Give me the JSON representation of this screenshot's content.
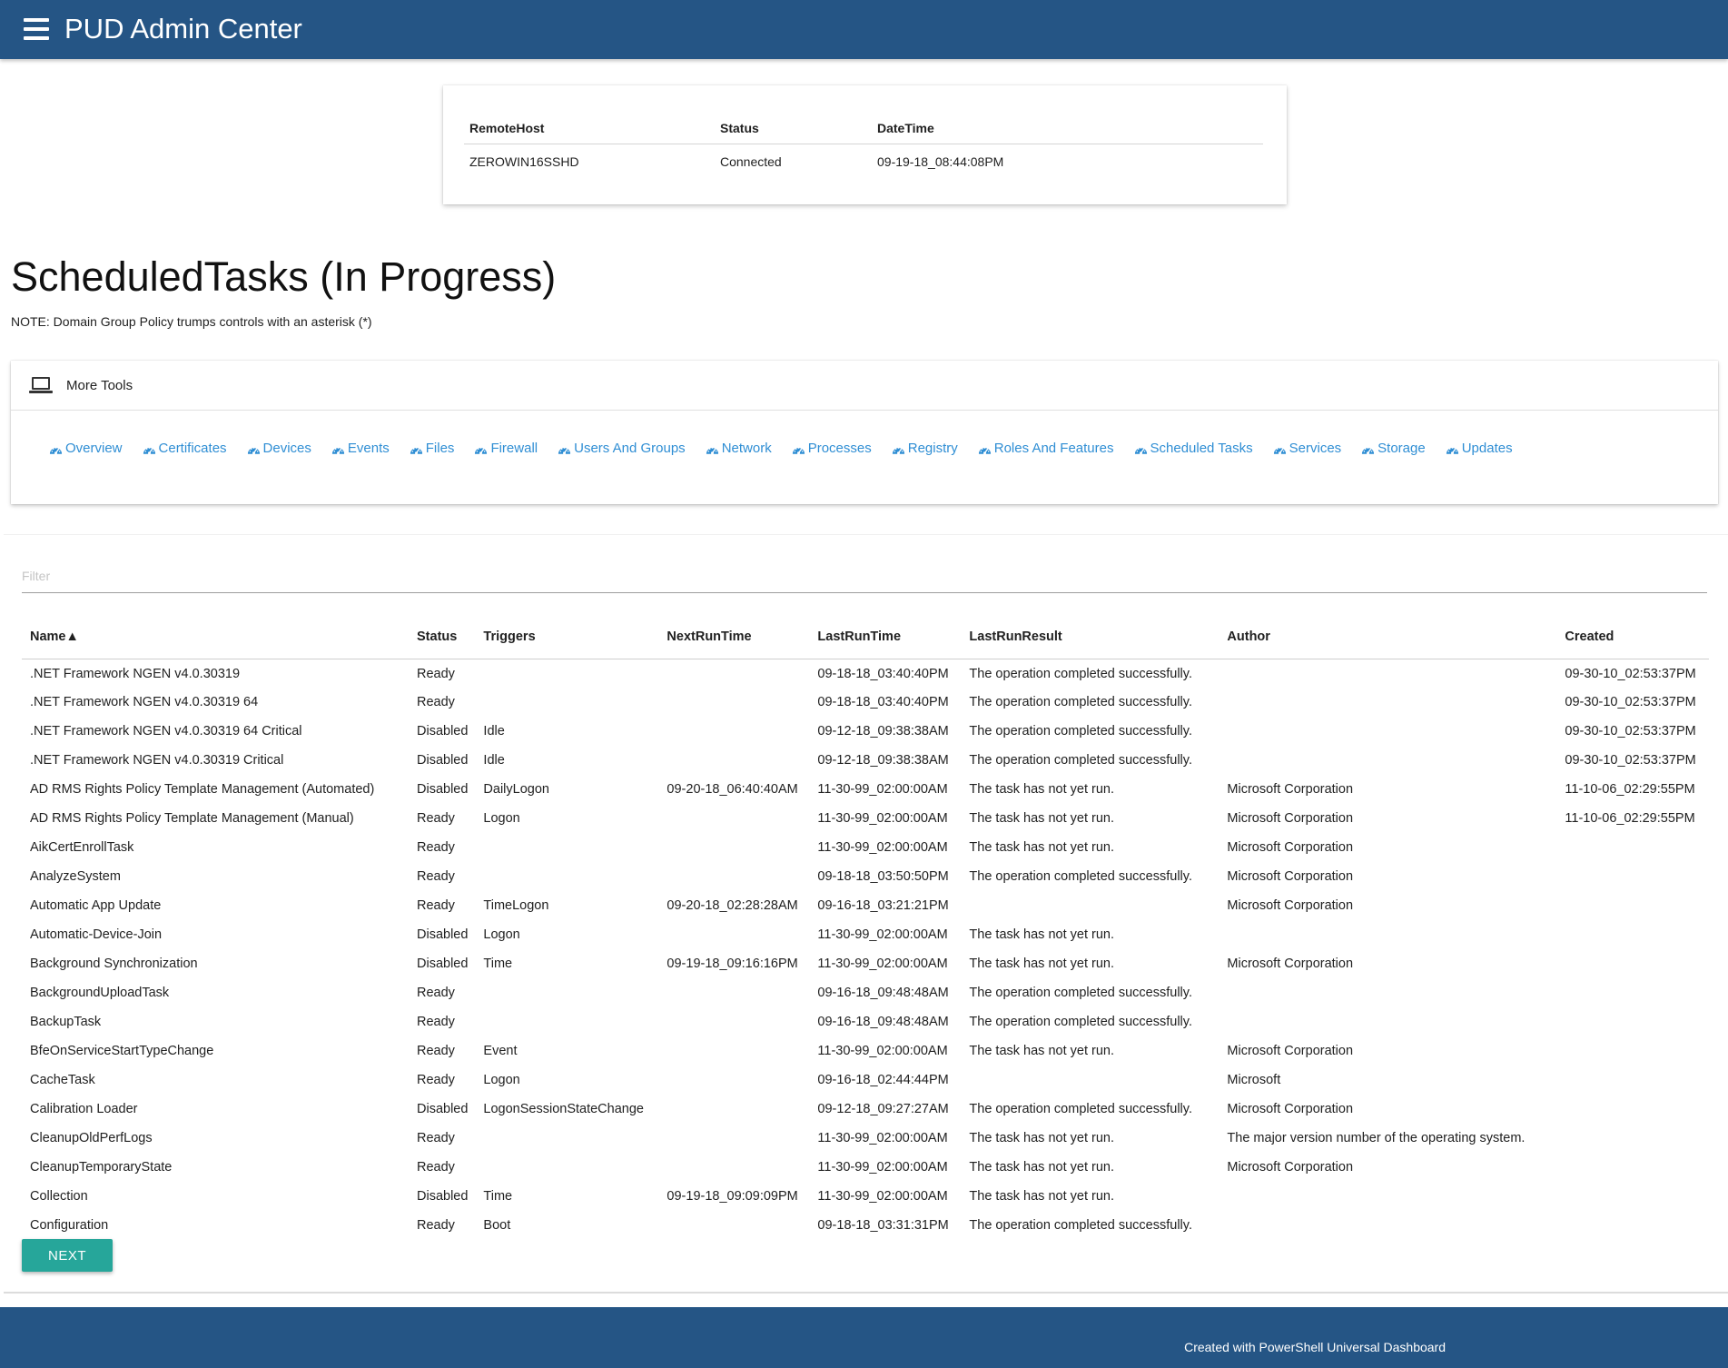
{
  "header": {
    "title": "PUD Admin Center",
    "menu_icon": "hamburger-menu-icon"
  },
  "connection": {
    "columns": [
      "RemoteHost",
      "Status",
      "DateTime"
    ],
    "row": {
      "remote_host": "ZEROWIN16SSHD",
      "status": "Connected",
      "datetime": "09-19-18_08:44:08PM"
    }
  },
  "page": {
    "title": "ScheduledTasks (In Progress)",
    "note": "NOTE: Domain Group Policy trumps controls with an asterisk (*)"
  },
  "tools": {
    "header_label": "More Tools",
    "header_icon": "laptop-icon",
    "link_icon": "dashboard-gauge-icon",
    "link_color": "#2f8ed4",
    "links": [
      "Overview",
      "Certificates",
      "Devices",
      "Events",
      "Files",
      "Firewall",
      "Users And Groups",
      "Network",
      "Processes",
      "Registry",
      "Roles And Features",
      "Scheduled Tasks",
      "Services",
      "Storage",
      "Updates"
    ]
  },
  "grid": {
    "filter_placeholder": "Filter",
    "columns": [
      "Name▲",
      "Status",
      "Triggers",
      "NextRunTime",
      "LastRunTime",
      "LastRunResult",
      "Author",
      "Created"
    ],
    "rows": [
      [
        ".NET Framework NGEN v4.0.30319",
        "Ready",
        "",
        "",
        "09-18-18_03:40:40PM",
        "The operation completed successfully.",
        "",
        "09-30-10_02:53:37PM"
      ],
      [
        ".NET Framework NGEN v4.0.30319 64",
        "Ready",
        "",
        "",
        "09-18-18_03:40:40PM",
        "The operation completed successfully.",
        "",
        "09-30-10_02:53:37PM"
      ],
      [
        ".NET Framework NGEN v4.0.30319 64 Critical",
        "Disabled",
        "Idle",
        "",
        "09-12-18_09:38:38AM",
        "The operation completed successfully.",
        "",
        "09-30-10_02:53:37PM"
      ],
      [
        ".NET Framework NGEN v4.0.30319 Critical",
        "Disabled",
        "Idle",
        "",
        "09-12-18_09:38:38AM",
        "The operation completed successfully.",
        "",
        "09-30-10_02:53:37PM"
      ],
      [
        "AD RMS Rights Policy Template Management (Automated)",
        "Disabled",
        "DailyLogon",
        "09-20-18_06:40:40AM",
        "11-30-99_02:00:00AM",
        "The task has not yet run.",
        "Microsoft Corporation",
        "11-10-06_02:29:55PM"
      ],
      [
        "AD RMS Rights Policy Template Management (Manual)",
        "Ready",
        "Logon",
        "",
        "11-30-99_02:00:00AM",
        "The task has not yet run.",
        "Microsoft Corporation",
        "11-10-06_02:29:55PM"
      ],
      [
        "AikCertEnrollTask",
        "Ready",
        "",
        "",
        "11-30-99_02:00:00AM",
        "The task has not yet run.",
        "Microsoft Corporation",
        ""
      ],
      [
        "AnalyzeSystem",
        "Ready",
        "",
        "",
        "09-18-18_03:50:50PM",
        "The operation completed successfully.",
        "Microsoft Corporation",
        ""
      ],
      [
        "Automatic App Update",
        "Ready",
        "TimeLogon",
        "09-20-18_02:28:28AM",
        "09-16-18_03:21:21PM",
        "",
        "Microsoft Corporation",
        ""
      ],
      [
        "Automatic-Device-Join",
        "Disabled",
        "Logon",
        "",
        "11-30-99_02:00:00AM",
        "The task has not yet run.",
        "",
        ""
      ],
      [
        "Background Synchronization",
        "Disabled",
        "Time",
        "09-19-18_09:16:16PM",
        "11-30-99_02:00:00AM",
        "The task has not yet run.",
        "Microsoft Corporation",
        ""
      ],
      [
        "BackgroundUploadTask",
        "Ready",
        "",
        "",
        "09-16-18_09:48:48AM",
        "The operation completed successfully.",
        "",
        ""
      ],
      [
        "BackupTask",
        "Ready",
        "",
        "",
        "09-16-18_09:48:48AM",
        "The operation completed successfully.",
        "",
        ""
      ],
      [
        "BfeOnServiceStartTypeChange",
        "Ready",
        "Event",
        "",
        "11-30-99_02:00:00AM",
        "The task has not yet run.",
        "Microsoft Corporation",
        ""
      ],
      [
        "CacheTask",
        "Ready",
        "Logon",
        "",
        "09-16-18_02:44:44PM",
        "",
        "Microsoft",
        ""
      ],
      [
        "Calibration Loader",
        "Disabled",
        "LogonSessionStateChange",
        "",
        "09-12-18_09:27:27AM",
        "The operation completed successfully.",
        "Microsoft Corporation",
        ""
      ],
      [
        "CleanupOldPerfLogs",
        "Ready",
        "",
        "",
        "11-30-99_02:00:00AM",
        "The task has not yet run.",
        "The major version number of the operating system.",
        ""
      ],
      [
        "CleanupTemporaryState",
        "Ready",
        "",
        "",
        "11-30-99_02:00:00AM",
        "The task has not yet run.",
        "Microsoft Corporation",
        ""
      ],
      [
        "Collection",
        "Disabled",
        "Time",
        "09-19-18_09:09:09PM",
        "11-30-99_02:00:00AM",
        "The task has not yet run.",
        "",
        ""
      ],
      [
        "Configuration",
        "Ready",
        "Boot",
        "",
        "09-18-18_03:31:31PM",
        "The operation completed successfully.",
        "",
        ""
      ]
    ],
    "next_label": "NEXT"
  },
  "footer": {
    "text": "Created with PowerShell Universal Dashboard"
  },
  "colors": {
    "brand": "#255585",
    "accent_button": "#26a69a",
    "link": "#2f8ed4"
  }
}
